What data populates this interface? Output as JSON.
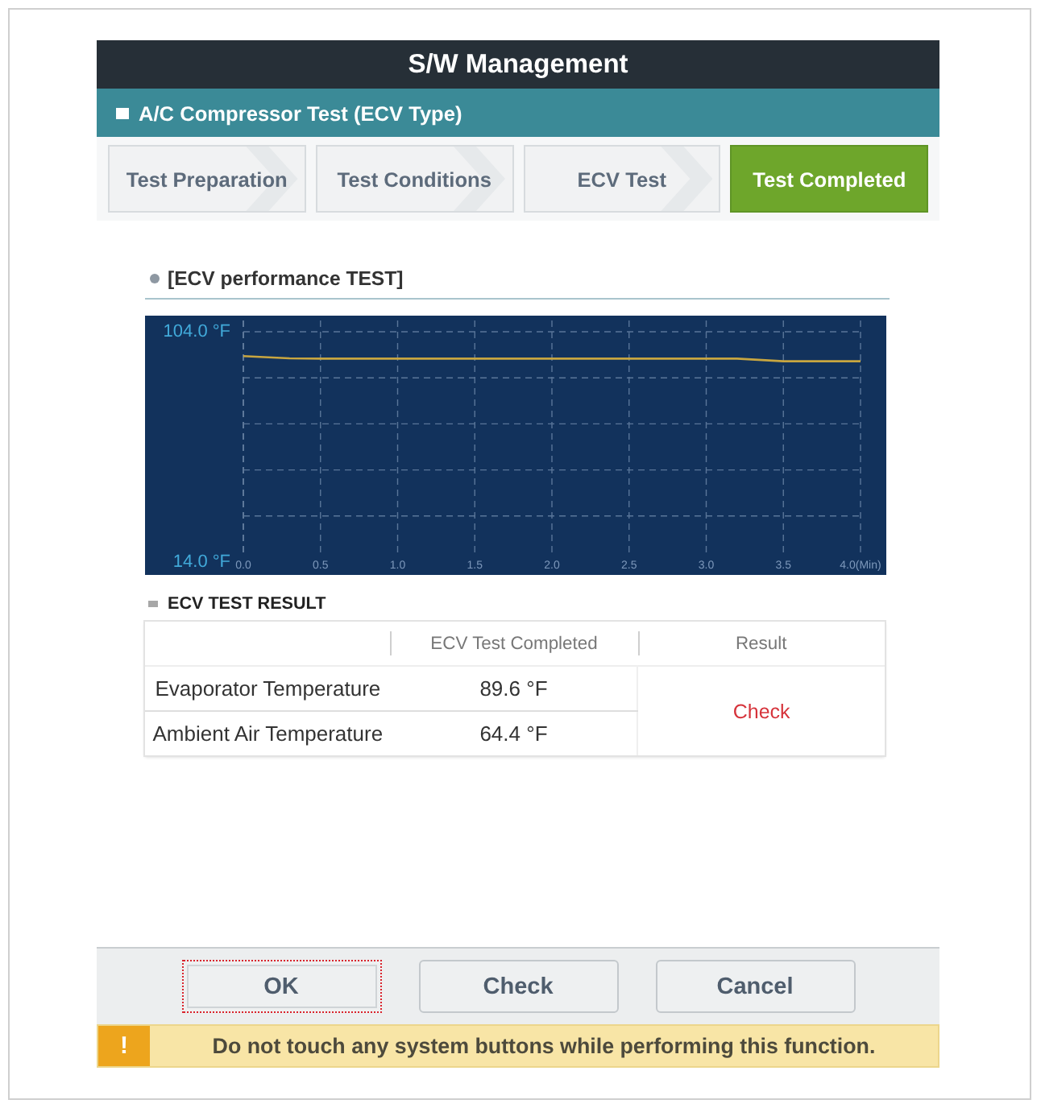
{
  "window": {
    "title": "S/W Management"
  },
  "test": {
    "title": "A/C Compressor Test (ECV Type)"
  },
  "tabs": [
    {
      "label": "Test Preparation",
      "selected": false
    },
    {
      "label": "Test Conditions",
      "selected": false
    },
    {
      "label": "ECV Test",
      "selected": false
    },
    {
      "label": "Test Completed",
      "selected": true
    }
  ],
  "performance": {
    "title": "[ECV performance TEST]",
    "chart_data": {
      "type": "line",
      "grid": true,
      "x": [
        0,
        0.3,
        0.5,
        1.0,
        1.5,
        2.0,
        2.5,
        3.0,
        3.2,
        3.5,
        4.0
      ],
      "series": [
        {
          "color": "#c8a640",
          "values": [
            94.5,
            93.6,
            93.5,
            93.5,
            93.5,
            93.5,
            93.5,
            93.5,
            93.5,
            92.5,
            92.5
          ]
        }
      ],
      "xlim": [
        0,
        4
      ],
      "ylim": [
        14,
        104
      ],
      "xticks": [
        {
          "value": 0,
          "label": "0.0"
        },
        {
          "value": 0.5,
          "label": "0.5"
        },
        {
          "value": 1,
          "label": "1.0"
        },
        {
          "value": 1.5,
          "label": "1.5"
        },
        {
          "value": 2,
          "label": "2.0"
        },
        {
          "value": 2.5,
          "label": "2.5"
        },
        {
          "value": 3,
          "label": "3.0"
        },
        {
          "value": 3.5,
          "label": "3.5"
        },
        {
          "value": 4,
          "label": "4.0(Min)"
        }
      ],
      "yticks": [
        {
          "value": 14,
          "label": "14.0 °F"
        },
        {
          "value": 104,
          "label": "104.0 °F"
        }
      ]
    }
  },
  "result_table": {
    "title": "ECV TEST RESULT",
    "columns": [
      "ECV Test Completed",
      "Result"
    ],
    "rows": [
      {
        "name": "Evaporator Temperature",
        "value": "89.6 °F"
      },
      {
        "name": "Ambient Air Temperature",
        "value": "64.4 °F"
      }
    ],
    "result": "Check"
  },
  "buttons": [
    {
      "label": "OK",
      "focused": true
    },
    {
      "label": "Check",
      "focused": false
    },
    {
      "label": "Cancel",
      "focused": false
    }
  ],
  "warning": {
    "icon": "!",
    "message": "Do not touch any system buttons while performing this function."
  }
}
